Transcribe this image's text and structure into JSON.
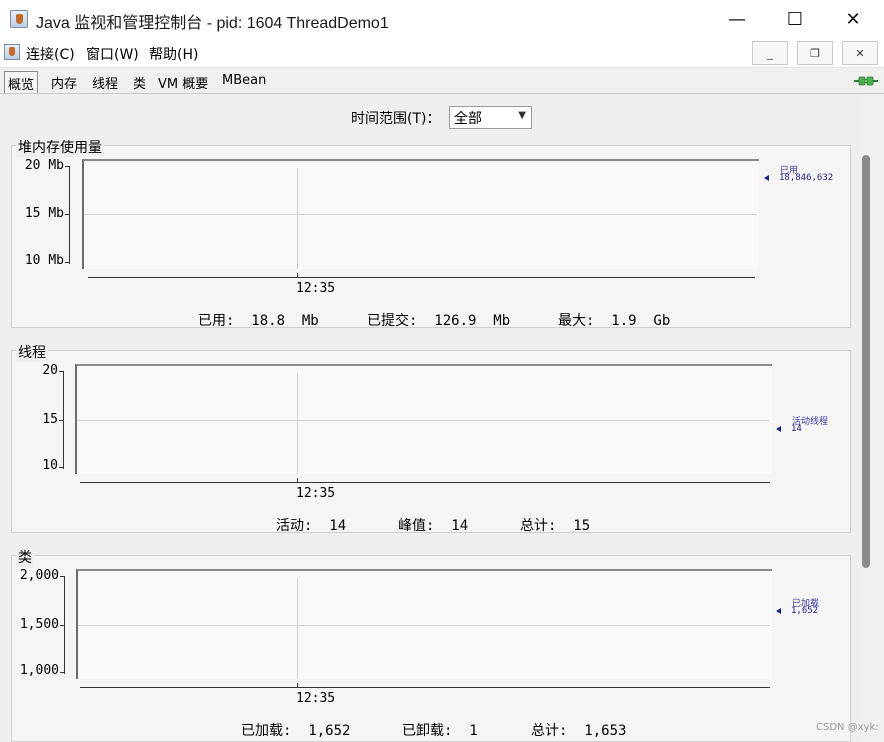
{
  "window": {
    "title": "Java 监视和管理控制台 - pid: 1604 ThreadDemo1",
    "minimize": "—",
    "maximize": "☐",
    "close": "✕"
  },
  "menu": {
    "items": [
      "连接(C)",
      "窗口(W)",
      "帮助(H)"
    ],
    "mdi_minimize": "_",
    "mdi_restore": "❐",
    "mdi_close": "✕"
  },
  "tabs": [
    "概览",
    "内存",
    "线程",
    "类",
    "VM 概要",
    "MBean"
  ],
  "time_range": {
    "label": "时间范围(T)：",
    "value": "全部"
  },
  "panels": [
    {
      "title": "堆内存使用量",
      "yticks": [
        "20 Mb",
        "15 Mb",
        "10 Mb"
      ],
      "xtick": "12:35",
      "legend_name": "已用",
      "legend_value": "18,846,632",
      "stats": [
        "已用:  18.8  Mb",
        "已提交:  126.9  Mb",
        "最大:  1.9  Gb"
      ]
    },
    {
      "title": "线程",
      "yticks": [
        "20",
        "15",
        "10"
      ],
      "xtick": "12:35",
      "legend_name": "活动线程",
      "legend_value": "14",
      "stats": [
        "活动:  14",
        "峰值:  14",
        "总计:  15"
      ]
    },
    {
      "title": "类",
      "yticks": [
        "2,000",
        "1,500",
        "1,000"
      ],
      "xtick": "12:35",
      "legend_name": "已加载",
      "legend_value": "1,652",
      "stats": [
        "已加载:  1,652",
        "已卸载:  1",
        "总计:  1,653"
      ]
    }
  ],
  "watermark": "CSDN @xyk:",
  "colors": {
    "legend": "#1c1c8c",
    "plug": "#4caf50"
  }
}
